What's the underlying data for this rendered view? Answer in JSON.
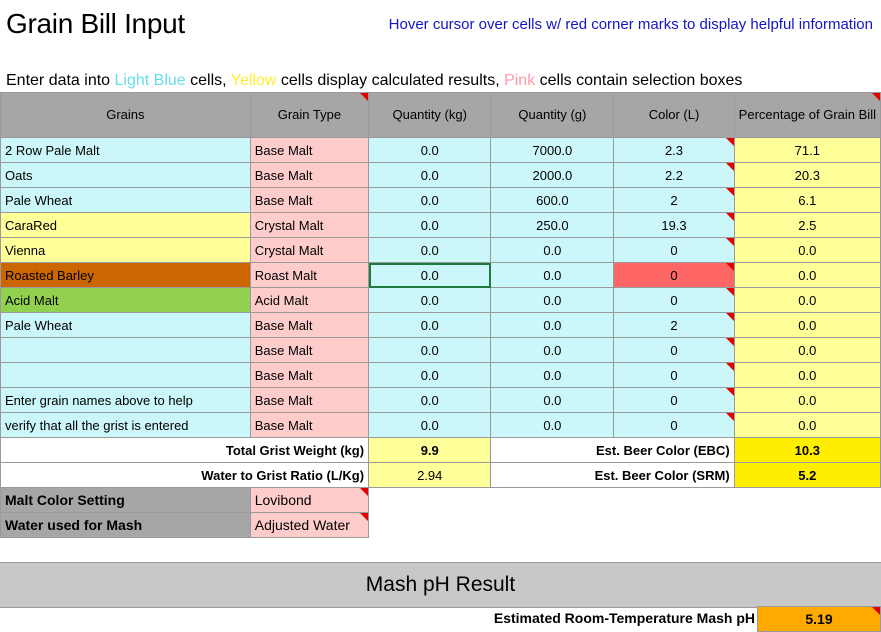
{
  "title": "Grain Bill Input",
  "hint": "Hover cursor over cells w/ red corner marks to display helpful information",
  "instructions": {
    "part1": "Enter data into ",
    "light_blue": "Light Blue",
    "part2": " cells, ",
    "yellow": "Yellow",
    "part3": "  cells display calculated results, ",
    "pink": "Pink",
    "part4": "  cells contain selection boxes"
  },
  "headers": {
    "grains": "Grains",
    "grain_type": "Grain Type",
    "qty_kg": "Quantity (kg)",
    "qty_g": "Quantity (g)",
    "color": "Color (L)",
    "pct": "Percentage of Grain Bill"
  },
  "rows": [
    {
      "name": "2 Row Pale Malt",
      "type": "Base Malt",
      "kg": "0.0",
      "g": "7000.0",
      "color": "2.3",
      "pct": "71.1"
    },
    {
      "name": "Oats",
      "type": "Base Malt",
      "kg": "0.0",
      "g": "2000.0",
      "color": "2.2",
      "pct": "20.3"
    },
    {
      "name": "Pale Wheat",
      "type": "Base Malt",
      "kg": "0.0",
      "g": "600.0",
      "color": "2",
      "pct": "6.1"
    },
    {
      "name": "CaraRed",
      "type": "Crystal Malt",
      "kg": "0.0",
      "g": "250.0",
      "color": "19.3",
      "pct": "2.5"
    },
    {
      "name": "Vienna",
      "type": "Crystal Malt",
      "kg": "0.0",
      "g": "0.0",
      "color": "0",
      "pct": "0.0"
    },
    {
      "name": "Roasted Barley",
      "type": "Roast Malt",
      "kg": "0.0",
      "g": "0.0",
      "color": "0",
      "pct": "0.0"
    },
    {
      "name": "Acid Malt",
      "type": "Acid Malt",
      "kg": "0.0",
      "g": "0.0",
      "color": "0",
      "pct": "0.0"
    },
    {
      "name": "Pale Wheat",
      "type": "Base Malt",
      "kg": "0.0",
      "g": "0.0",
      "color": "2",
      "pct": "0.0"
    },
    {
      "name": "",
      "type": "Base Malt",
      "kg": "0.0",
      "g": "0.0",
      "color": "0",
      "pct": "0.0"
    },
    {
      "name": "",
      "type": "Base Malt",
      "kg": "0.0",
      "g": "0.0",
      "color": "0",
      "pct": "0.0"
    },
    {
      "name": "Enter grain names above to help",
      "type": "Base Malt",
      "kg": "0.0",
      "g": "0.0",
      "color": "0",
      "pct": "0.0"
    },
    {
      "name": "verify that all the grist is entered",
      "type": "Base Malt",
      "kg": "0.0",
      "g": "0.0",
      "color": "0",
      "pct": "0.0"
    }
  ],
  "totals": {
    "grist_label": "Total Grist Weight (kg)",
    "grist_value": "9.9",
    "ratio_label": "Water to Grist Ratio (L/Kg)",
    "ratio_value": "2.94",
    "ebc_label": "Est. Beer Color (EBC)",
    "ebc_value": "10.3",
    "srm_label": "Est. Beer Color (SRM)",
    "srm_value": "5.2"
  },
  "settings": {
    "malt_color_label": "Malt Color Setting",
    "malt_color_value": "Lovibond",
    "water_label": "Water used for Mash",
    "water_value": "Adjusted Water"
  },
  "mash": {
    "heading": "Mash pH Result",
    "ph_label": "Estimated Room-Temperature Mash pH",
    "ph_value": "5.19"
  },
  "colors": {
    "light_blue": "#ccf7fa",
    "yellow": "#ffff99",
    "pink": "#ffcccc",
    "roasted_barley": "#cc6600",
    "acid_malt": "#92d050",
    "alert_red": "#ff6666",
    "mash_ph_orange": "#ffaa00"
  }
}
